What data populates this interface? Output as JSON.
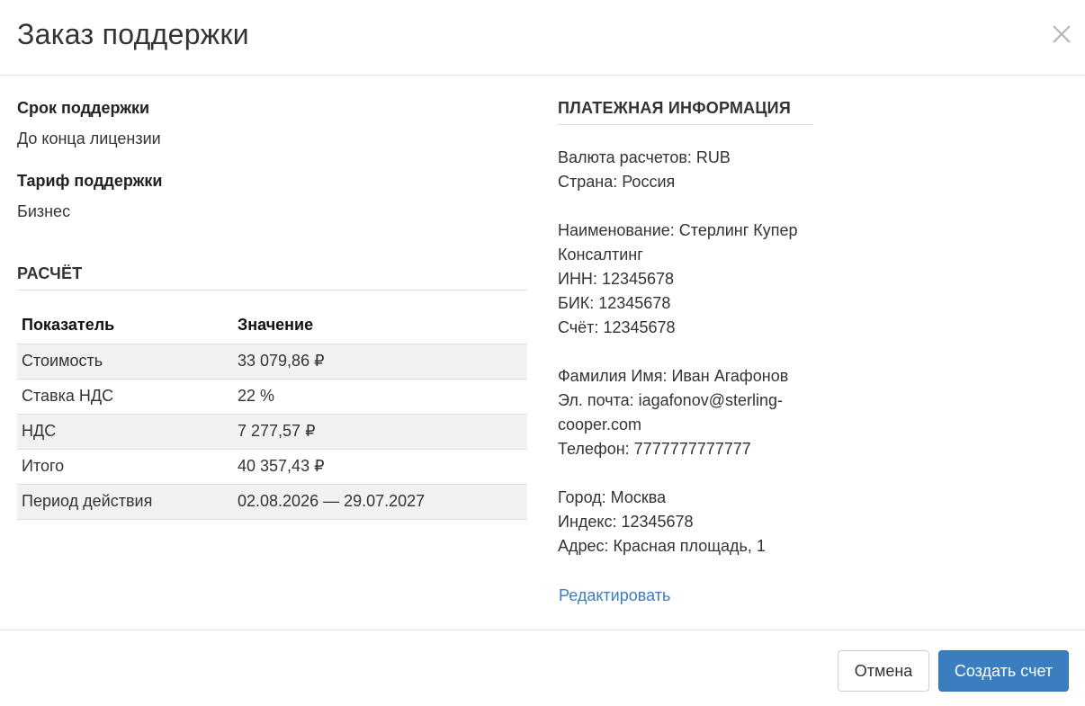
{
  "header": {
    "title": "Заказ поддержки"
  },
  "left": {
    "support_term": {
      "label": "Срок поддержки",
      "value": "До конца лицензии"
    },
    "support_tariff": {
      "label": "Тариф поддержки",
      "value": "Бизнес"
    },
    "calc_section_title": "РАСЧЁТ",
    "table": {
      "headers": [
        "Показатель",
        "Значение"
      ],
      "rows": [
        [
          "Стоимость",
          "33 079,86 ₽"
        ],
        [
          "Ставка НДС",
          "22 %"
        ],
        [
          "НДС",
          "7 277,57 ₽"
        ],
        [
          "Итого",
          "40 357,43 ₽"
        ],
        [
          "Период действия",
          "02.08.2026 — 29.07.2027"
        ]
      ]
    }
  },
  "right": {
    "section_title": "ПЛАТЕЖНАЯ ИНФОРМАЦИЯ",
    "currency": "Валюта расчетов: RUB",
    "country": "Страна: Россия",
    "name_line1": "Наименование: Стерлинг Купер",
    "name_line2": "Консалтинг",
    "inn": "ИНН: 12345678",
    "bik": "БИК: 12345678",
    "account": "Счёт: 12345678",
    "person": "Фамилия Имя: Иван Агафонов",
    "email_line1": "Эл. почта: iagafonov@sterling-",
    "email_line2": "cooper.com",
    "phone": "Телефон: 7777777777777",
    "city": "Город: Москва",
    "postcode": "Индекс: 12345678",
    "address": "Адрес: Красная площадь, 1",
    "edit_label": "Редактировать"
  },
  "footer": {
    "cancel_label": "Отмена",
    "submit_label": "Создать счет"
  },
  "colors": {
    "primary": "#3a7ebf",
    "stripe": "#f2f2f2",
    "border": "#e5e5e5"
  },
  "icons": {
    "close": "close-icon"
  }
}
